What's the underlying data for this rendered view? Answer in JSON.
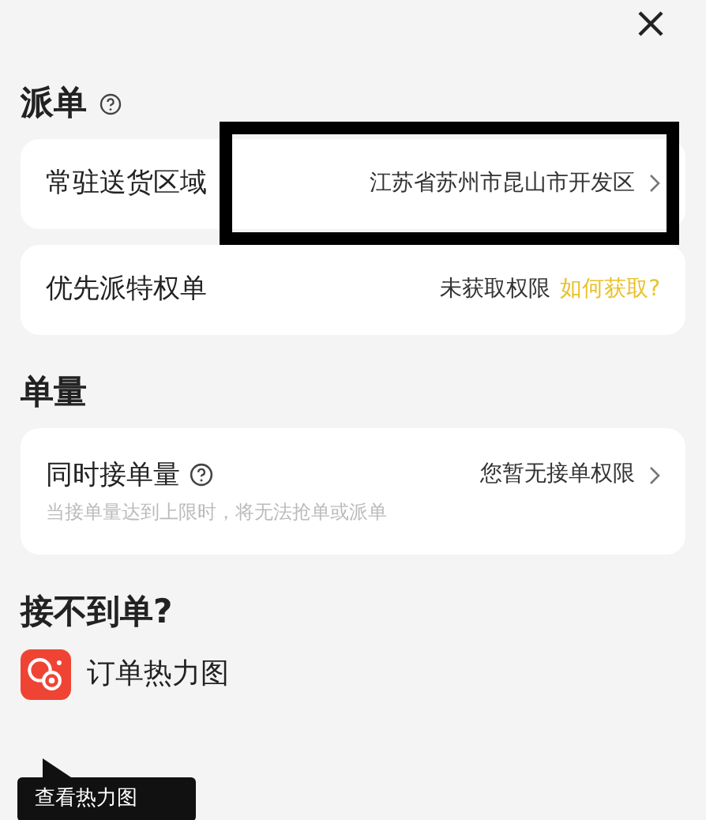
{
  "annotation_box": true,
  "sections": [
    {
      "title": "派单",
      "help": true,
      "rows": [
        {
          "label": "常驻送货区域",
          "value": "江苏省苏州市昆山市开发区",
          "chevron": true
        },
        {
          "label": "优先派特权单",
          "value": "未获取权限",
          "link": "如何获取?"
        }
      ]
    },
    {
      "title": "单量",
      "rows": [
        {
          "label": "同时接单量",
          "help": true,
          "value": "您暂无接单权限",
          "chevron": true,
          "note": "当接单量达到上限时，将无法抢单或派单"
        }
      ]
    },
    {
      "title": "接不到单?",
      "tools": [
        {
          "label": "订单热力图"
        }
      ]
    }
  ],
  "tooltip": {
    "text": "查看热力图"
  }
}
